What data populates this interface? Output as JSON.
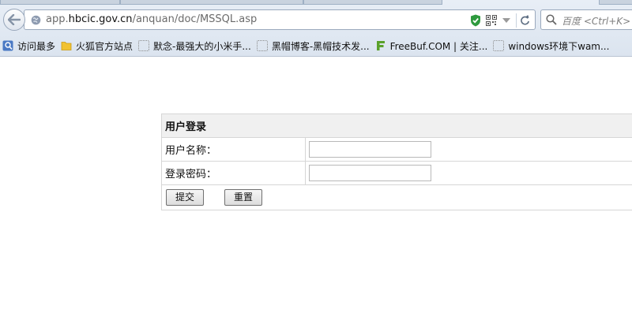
{
  "browser": {
    "url_prefix": "app.",
    "url_domain": "hbcic.gov.cn",
    "url_path": "/anquan/doc/MSSQL.asp",
    "search_placeholder": "百度 <Ctrl+K>"
  },
  "bookmarks": [
    {
      "label": "访问最多",
      "icon": "most-visited-icon"
    },
    {
      "label": "火狐官方站点",
      "icon": "folder-icon"
    },
    {
      "label": "默念-最强大的小米手...",
      "icon": "page-icon"
    },
    {
      "label": "黑帽博客-黑帽技术发...",
      "icon": "page-icon"
    },
    {
      "label": "FreeBuf.COM | 关注...",
      "icon": "freebuf-icon"
    },
    {
      "label": "windows环境下wam...",
      "icon": "page-icon"
    }
  ],
  "form": {
    "title": "用户登录",
    "username_label": "用户名称：",
    "password_label": "登录密码：",
    "username_value": "",
    "password_value": "",
    "submit_label": "提交",
    "reset_label": "重置"
  },
  "colors": {
    "shield_green": "#2e9a3e",
    "freebuf_green": "#5aa12a",
    "folder_yellow": "#f1c232"
  }
}
